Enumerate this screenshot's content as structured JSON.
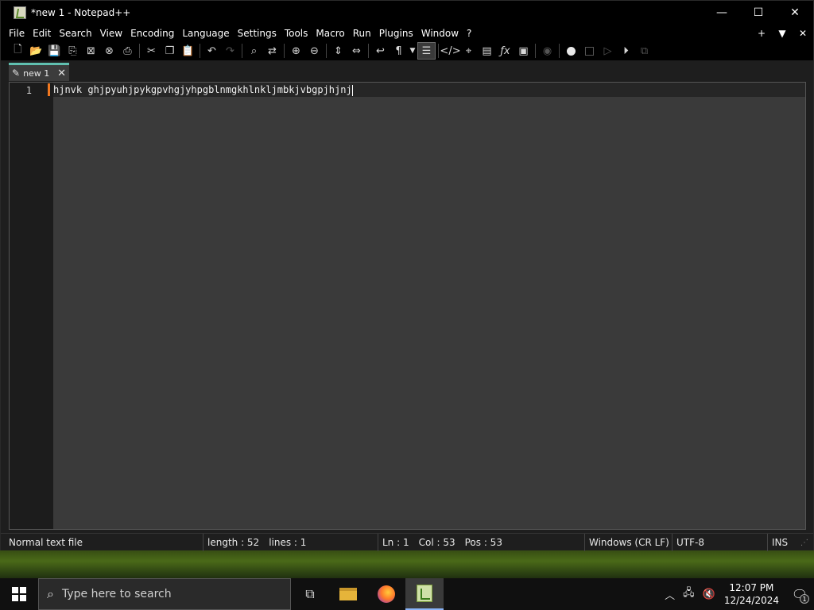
{
  "window": {
    "title": "*new 1 - Notepad++",
    "minimize": "—",
    "maximize": "☐",
    "close": "✕"
  },
  "menu": {
    "items": [
      "File",
      "Edit",
      "Search",
      "View",
      "Encoding",
      "Language",
      "Settings",
      "Tools",
      "Macro",
      "Run",
      "Plugins",
      "Window",
      "?"
    ],
    "right": [
      "+",
      "▼",
      "✕"
    ]
  },
  "toolbar": {
    "icons": [
      "new-file",
      "open",
      "save",
      "save-all",
      "close",
      "close-all",
      "print",
      "cut",
      "copy",
      "paste",
      "undo",
      "redo",
      "find",
      "replace",
      "zoom-in",
      "zoom-out",
      "sync-vertical",
      "sync-horizontal",
      "word-wrap",
      "show-all-chars",
      "indent-guide",
      "function-list",
      "document-map",
      "document-list",
      "folder-as-workspace",
      "monitoring",
      "record-macro",
      "stop-recording",
      "play-macro",
      "run-macro-multiple",
      "save-macro"
    ]
  },
  "tabs": [
    {
      "label": "new 1",
      "close": "✕",
      "modified": true
    }
  ],
  "editor": {
    "lines": [
      {
        "number": "1",
        "text": "hjnvk ghjpyuhjpykgpvhgjyhpgblnmgkhlnkljmbkjvbgpjhjnj"
      }
    ]
  },
  "status": {
    "file_type": "Normal text file",
    "length": "length : 52",
    "lines": "lines : 1",
    "ln": "Ln : 1",
    "col": "Col : 53",
    "pos": "Pos : 53",
    "eol": "Windows (CR LF)",
    "encoding": "UTF-8",
    "mode": "INS"
  },
  "taskbar": {
    "search_placeholder": "Type here to search",
    "time": "12:07 PM",
    "date": "12/24/2024",
    "notification_count": "1"
  }
}
